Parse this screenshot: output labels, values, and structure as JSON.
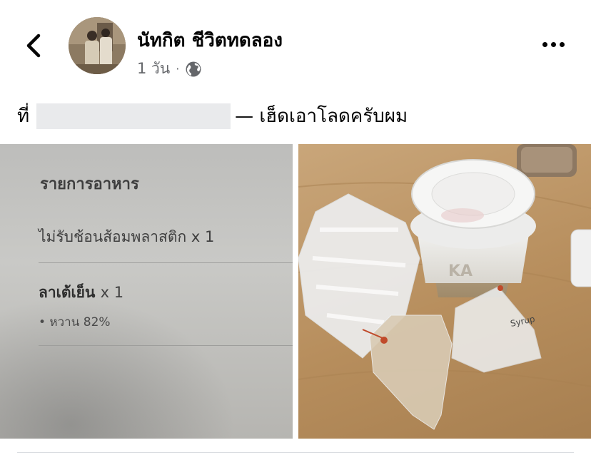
{
  "header": {
    "author_name": "นัทกิต ชีวิตทดลอง",
    "timestamp": "1 วัน",
    "separator": "·",
    "privacy_icon": "globe-icon",
    "back_icon": "chevron-left-icon",
    "more_icon": "more-dots-icon"
  },
  "post": {
    "caption_prefix": "ที่",
    "caption_suffix": "— เฮ็ดเอาโลดครับผม"
  },
  "photos": {
    "receipt": {
      "title": "รายการอาหาร",
      "item1": "ไม่รับช้อนส้อมพลาสติก x 1",
      "item2_name": "ลาเต้เย็น",
      "item2_qty": "x 1",
      "item2_option": "• หวาน 82%"
    },
    "drink": {
      "bag_label": "Syrup"
    }
  },
  "colors": {
    "text_primary": "#050505",
    "text_secondary": "#65676b",
    "divider": "#dadde1"
  }
}
